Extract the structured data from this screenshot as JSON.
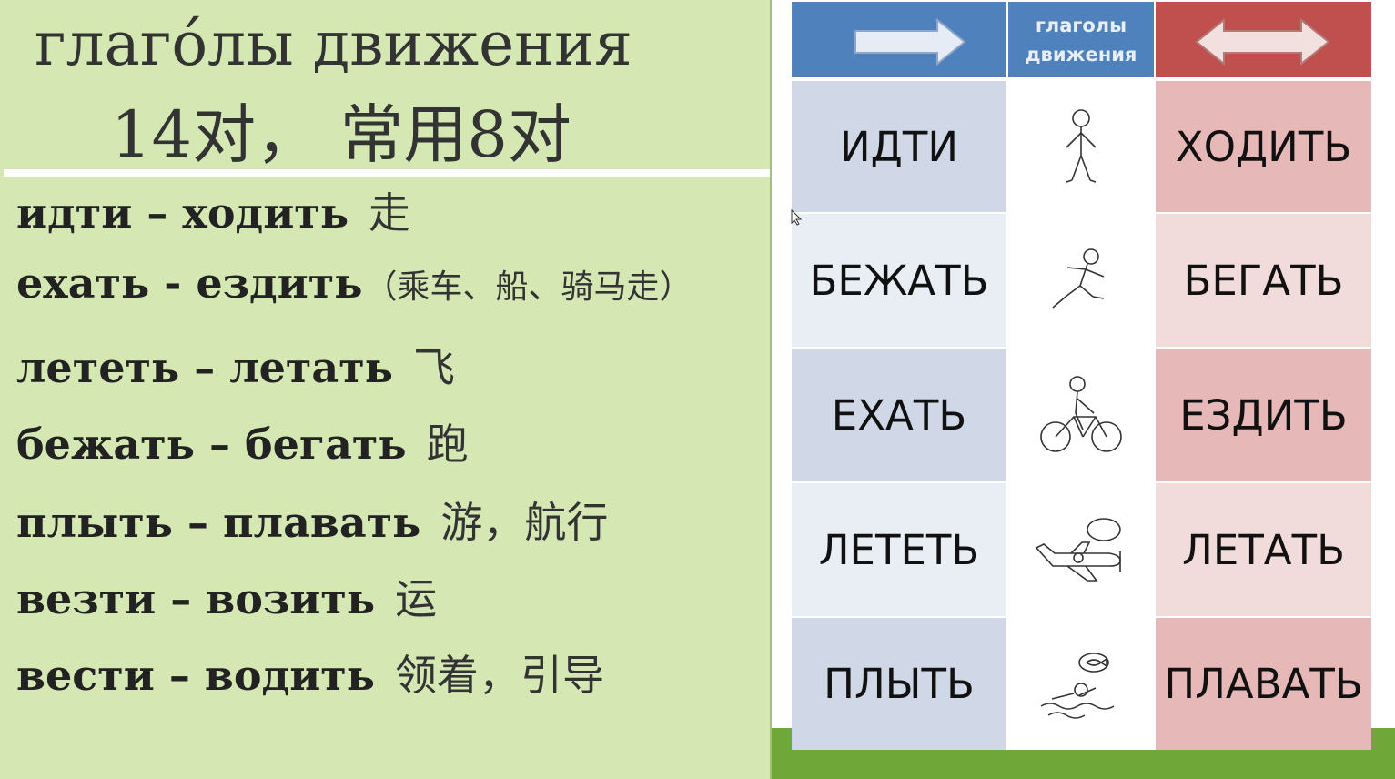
{
  "slide": {
    "title_line1": "глаго́лы движения",
    "title_line2": "14对， 常用8对"
  },
  "verb_pairs": [
    {
      "ru": "идти – ходить",
      "cn": "走"
    },
    {
      "ru": "ехать - ездить",
      "cn": "（乘车、船、骑马走）"
    },
    {
      "ru": "лететь – летать",
      "cn": "飞"
    },
    {
      "ru": "бежать – бегать",
      "cn": "跑"
    },
    {
      "ru": "плыть – плавать",
      "cn": "游，航行"
    },
    {
      "ru": "везти – возить",
      "cn": "运"
    },
    {
      "ru": "вести – водить",
      "cn": "领着，引导"
    }
  ],
  "table": {
    "header_mid": "глаголы движения",
    "header_left_icon": "right-arrow-icon",
    "header_right_icon": "double-arrow-icon",
    "rows": [
      {
        "left": "ИДТИ",
        "icon": "walking-man-icon",
        "right": "ХОДИТЬ"
      },
      {
        "left": "БЕЖАТЬ",
        "icon": "running-man-icon",
        "right": "БЕГАТЬ"
      },
      {
        "left": "ЕХАТЬ",
        "icon": "bicycle-rider-icon",
        "right": "ЕЗДИТЬ"
      },
      {
        "left": "ЛЕТЕТЬ",
        "icon": "airplane-icon",
        "right": "ЛЕТАТЬ"
      },
      {
        "left": "ПЛЫТЬ",
        "icon": "swimmer-icon",
        "right": "ПЛАВАТЬ"
      }
    ]
  },
  "colors": {
    "slide_bg": "#d5e8b4",
    "header_blue": "#4f81bd",
    "header_red": "#c0504d",
    "accent_green": "#6fa838"
  }
}
